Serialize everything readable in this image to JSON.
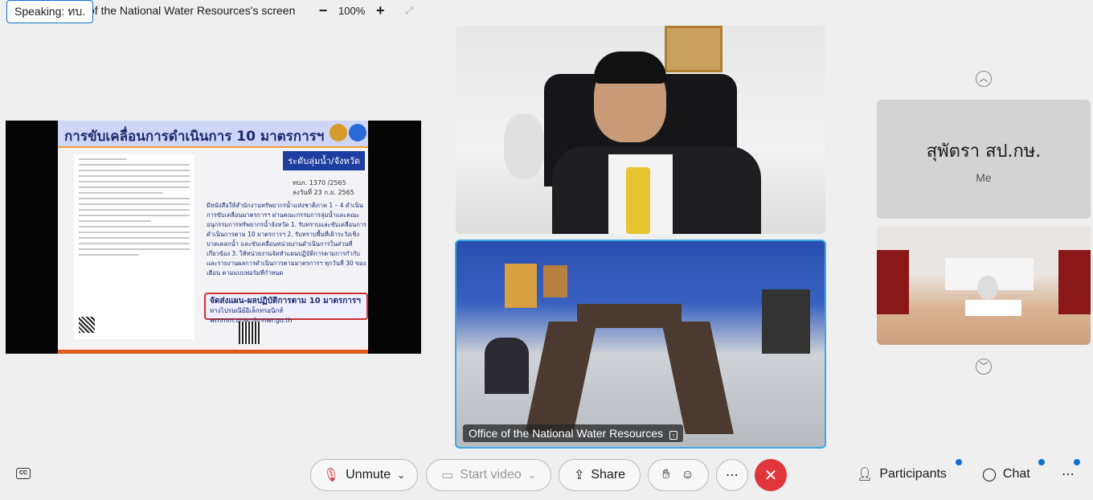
{
  "top_bar": {
    "speaking": "Speaking: ทบ.",
    "share_title": "of the National Water Resources's screen",
    "zoom_out": "−",
    "zoom_level": "100%",
    "zoom_in": "+"
  },
  "shared_slide": {
    "title": "การขับเคลื่อนการดำเนินการ 10 มาตรการฯ",
    "tag": "ระดับลุ่มน้ำ/จังหวัด",
    "ref_no": "ทบภ. 1370 /2565",
    "ref_date": "ลงวันที่ 23 ก.ย. 2565",
    "body": "มีหนังสือให้สำนักงานทรัพยากรน้ำแห่งชาติภาค 1 – 4 ดำเนินการขับเคลื่อนมาตรการฯ ผ่านคณะกรรมการลุ่มน้ำและคณะอนุกรรมการทรัพยากรน้ำจังหวัด 1. รับทราบและขับเคลื่อนการดำเนินการตาม 10 มาตรการฯ 2. รับทราบพื้นที่เฝ้าระวังเชิงบาดเคลกน้ำ และขับเคลื่อนหน่วยงานดำเนินการในส่วนที่เกี่ยวข้อง 3. ให้หน่วยงานจัดทำแผนปฏิบัติการตามการกำกับและรายงานผลการดำเนินการตามมาตรการฯ ทุกวันที่ 30 ของเดือน ตามแบบฟอร์มที่กำหนด",
    "box_title": "จัดส่งแผน-ผลปฏิบัติการตาม 10 มาตรการฯ",
    "box_email": "ทางไปรษณีย์อิเล็กทรอนิกส์ wmmm.onwr@onwr.go.th"
  },
  "tiles": {
    "room_name": "Office of the National Water Resources"
  },
  "self_tile": {
    "name": "สุพัตรา สป.กษ.",
    "label": "Me"
  },
  "bottom_bar": {
    "unmute": "Unmute",
    "start_video": "Start video",
    "share": "Share",
    "participants": "Participants",
    "chat": "Chat",
    "more": "⋯",
    "more_right": "⋯"
  },
  "colors": {
    "accent": "#1170cf",
    "leave": "#e0353a",
    "active_border": "#3ea8e0"
  }
}
